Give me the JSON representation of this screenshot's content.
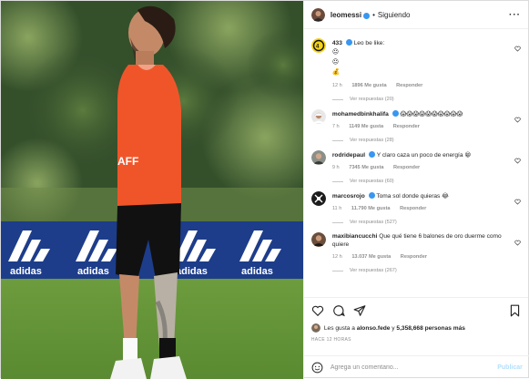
{
  "header": {
    "username": "leomessi",
    "separator": "•",
    "follow_status": "Siguiendo",
    "more_icon": "ellipsis-icon"
  },
  "comments": [
    {
      "user": "433",
      "verified": true,
      "text": "Leo be like:",
      "emojis": [
        "😐",
        "😐",
        "💰"
      ],
      "time": "12 h",
      "likes": "1896 Me gusta",
      "reply": "Responder",
      "view_replies": "Ver respuestas (20)"
    },
    {
      "user": "mohamedbinkhalifa",
      "verified": true,
      "text": "😱😱😱😱😱😱😱😱😱😱",
      "time": "7 h",
      "likes": "1149 Me gusta",
      "reply": "Responder",
      "view_replies": "Ver respuestas (28)"
    },
    {
      "user": "rodridepaul",
      "verified": true,
      "text": "Y claro caza un poco de energía 😁",
      "time": "9 h",
      "likes": "7345 Me gusta",
      "reply": "Responder",
      "view_replies": "Ver respuestas (60)"
    },
    {
      "user": "marcosrojo",
      "verified": true,
      "text": "Toma sol donde quieras 😂",
      "time": "11 h",
      "likes": "11.790 Me gusta",
      "reply": "Responder",
      "view_replies": "Ver respuestas (527)"
    },
    {
      "user": "maxibiancucchi",
      "verified": false,
      "text": "Que qué tiene 6 balones de oro duerme como quiere",
      "time": "12 h",
      "likes": "13.037 Me gusta",
      "reply": "Responder",
      "view_replies": "Ver respuestas (267)"
    }
  ],
  "actions": {
    "like_icon": "heart-icon",
    "comment_icon": "comment-icon",
    "share_icon": "share-icon",
    "save_icon": "bookmark-icon"
  },
  "likes_line": {
    "prefix": "Les gusta a",
    "user": "alonso.fede",
    "middle": "y",
    "count": "5,358,668 personas más"
  },
  "timestamp": "HACE 12 HORAS",
  "add_comment": {
    "placeholder": "Agrega un comentario...",
    "post_label": "Publicar",
    "emoji_icon": "smiley-icon"
  },
  "photo": {
    "board_text": [
      "adidas",
      "adidas",
      "adidas",
      "adidas"
    ],
    "shirt_text": "AFF"
  },
  "colors": {
    "verified_blue": "#3897f0",
    "bib_orange": "#f0552a",
    "board_blue": "#1d3d8a"
  }
}
